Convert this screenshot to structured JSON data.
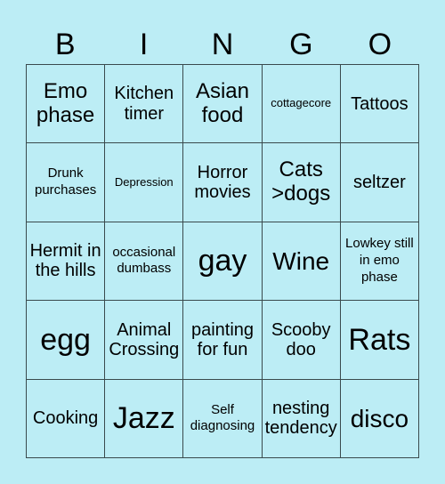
{
  "header": {
    "letters": [
      "B",
      "I",
      "N",
      "G",
      "O"
    ]
  },
  "board": {
    "rows": [
      [
        "Emo phase",
        "Kitchen timer",
        "Asian food",
        "cottagecore",
        "Tattoos"
      ],
      [
        "Drunk purchases",
        "Depression",
        "Horror movies",
        "Cats >dogs",
        "seltzer"
      ],
      [
        "Hermit in the hills",
        "occasional dumbass",
        "gay",
        "Wine",
        "Lowkey still in emo phase"
      ],
      [
        "egg",
        "Animal Crossing",
        "painting for fun",
        "Scooby doo",
        "Rats"
      ],
      [
        "Cooking",
        "Jazz",
        "Self diagnosing",
        "nesting tendency",
        "disco"
      ]
    ]
  },
  "colors": {
    "background": "#bcedf5",
    "grid_line": "#3a4a4d",
    "text": "#000000"
  }
}
